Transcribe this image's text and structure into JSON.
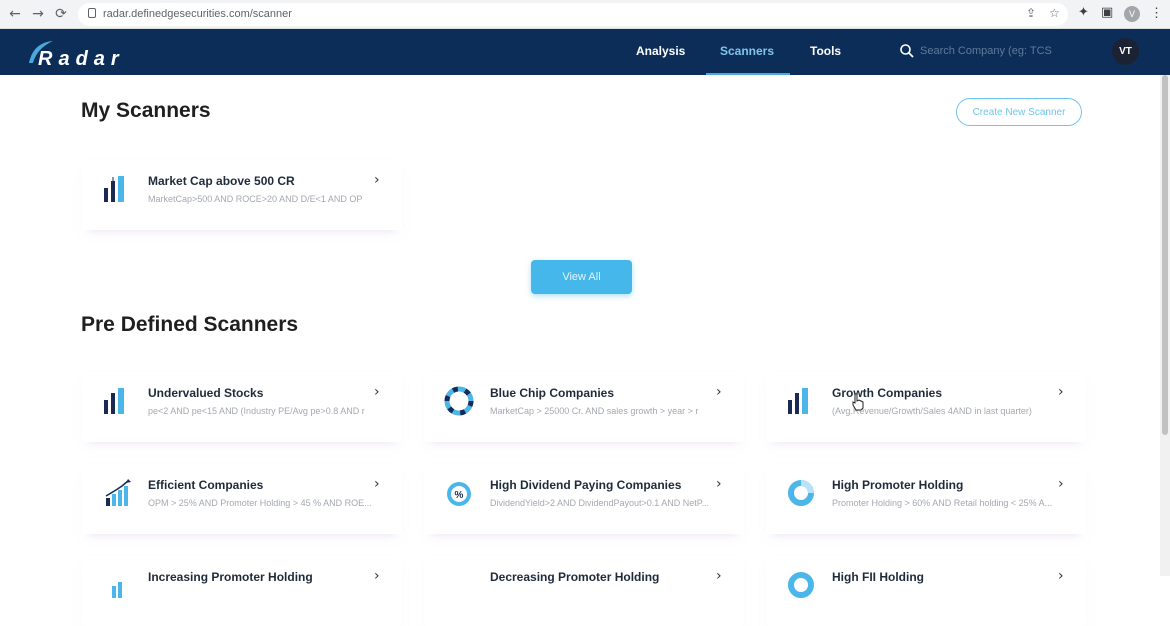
{
  "browser": {
    "back_icon": "←",
    "forward_icon": "→",
    "reload_icon": "⟳",
    "url": "radar.definedgesecurities.com/scanner",
    "share_icon": "⇪",
    "star_icon": "☆",
    "extensions_icon": "✦",
    "sidepanel_icon": "▣",
    "profile_initial": "V",
    "menu_icon": "⋮"
  },
  "header": {
    "logo_text": "Radar",
    "nav": [
      {
        "label": "Analysis"
      },
      {
        "label": "Scanners",
        "active": true
      },
      {
        "label": "Tools"
      }
    ],
    "search_placeholder": "Search Company (eg: TCS",
    "avatar_initials": "VT"
  },
  "my_scanners": {
    "title": "My Scanners",
    "create_button": "Create New Scanner",
    "items": [
      {
        "name": "Market Cap above 500 CR",
        "description": "MarketCap>500 AND ROCE>20 AND D/E<1 AND OP",
        "icon": "bar-chart-icon"
      }
    ],
    "view_all": "View All"
  },
  "predefined": {
    "title": "Pre Defined Scanners",
    "items": [
      {
        "name": "Undervalued Stocks",
        "description": "pe<2 AND pe<15 AND (Industry PE/Avg pe>0.8 AND r",
        "icon": "bar-chart-icon"
      },
      {
        "name": "Blue Chip Companies",
        "description": "MarketCap > 25000 Cr. AND sales growth > year > r",
        "icon": "lifebuoy-icon"
      },
      {
        "name": "Growth Companies",
        "description": "(Avg.Revenue/Growth/Sales 4AND in last quarter)",
        "icon": "bar-chart-icon"
      },
      {
        "name": "Efficient Companies",
        "description": "OPM > 25% AND Promoter Holding > 45 % AND ROE...",
        "icon": "growth-arrow-icon"
      },
      {
        "name": "High Dividend Paying Companies",
        "description": "DividendYield>2 AND DividendPayout>0.1 AND NetP...",
        "icon": "percent-icon"
      },
      {
        "name": "High Promoter Holding",
        "description": "Promoter Holding > 60% AND Retail holding < 25% A...",
        "icon": "donut-icon"
      },
      {
        "name": "Increasing Promoter Holding",
        "description": "",
        "icon": "growth-arrow-icon"
      },
      {
        "name": "Decreasing Promoter Holding",
        "description": "",
        "icon": "percent-icon"
      },
      {
        "name": "High FII Holding",
        "description": "",
        "icon": "donut-icon"
      }
    ]
  },
  "colors": {
    "header_bg": "#0c2d57",
    "accent": "#46b7ea",
    "nav_active": "#7fc6ea"
  }
}
